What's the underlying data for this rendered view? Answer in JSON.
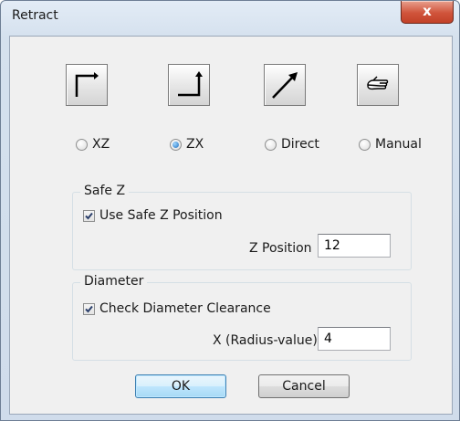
{
  "window": {
    "title": "Retract",
    "close_glyph": "x"
  },
  "toolbar": {
    "buttons": [
      {
        "name": "retract-xz-icon"
      },
      {
        "name": "retract-zx-icon"
      },
      {
        "name": "retract-direct-icon"
      },
      {
        "name": "retract-manual-icon"
      }
    ]
  },
  "retract_mode": {
    "options": [
      "XZ",
      "ZX",
      "Direct",
      "Manual"
    ],
    "selected": "ZX"
  },
  "safe_z": {
    "legend": "Safe Z",
    "checkbox_label": "Use Safe Z Position",
    "checked": true,
    "field_label": "Z Position",
    "value": "12"
  },
  "diameter": {
    "legend": "Diameter",
    "checkbox_label": "Check Diameter Clearance",
    "checked": true,
    "field_label": "X (Radius-value)",
    "value": "4"
  },
  "buttons": {
    "ok_label": "OK",
    "cancel_label": "Cancel"
  },
  "colors": {
    "accent": "#3c7fb1",
    "close": "#c24128",
    "client": "#f0f0f0"
  }
}
